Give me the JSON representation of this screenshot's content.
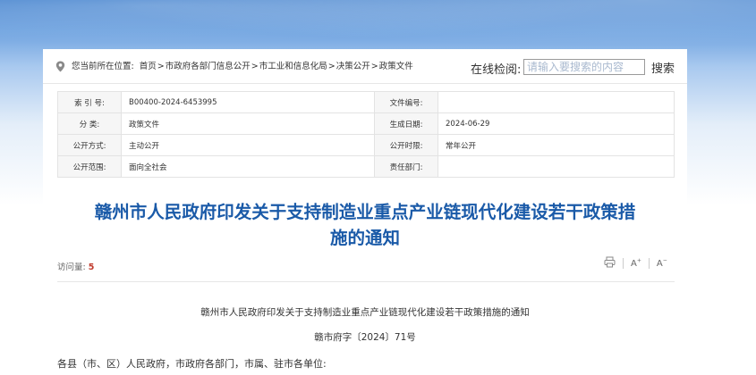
{
  "breadcrumb": {
    "prefix": "您当前所在位置:",
    "items": [
      "首页",
      "市政府各部门信息公开",
      "市工业和信息化局",
      "决策公开",
      "政策文件"
    ],
    "separator": ">"
  },
  "search": {
    "label": "在线检阅:",
    "placeholder": "请输入要搜索的内容",
    "button": "搜索"
  },
  "info_table": {
    "rows": [
      {
        "k1": "索 引 号:",
        "v1": "B00400-2024-6453995",
        "k2": "文件编号:",
        "v2": ""
      },
      {
        "k1": "分    类:",
        "v1": "政策文件",
        "k2": "生成日期:",
        "v2": "2024-06-29"
      },
      {
        "k1": "公开方式:",
        "v1": "主动公开",
        "k2": "公开时限:",
        "v2": "常年公开"
      },
      {
        "k1": "公开范围:",
        "v1": "面向全社会",
        "k2": "责任部门:",
        "v2": ""
      }
    ]
  },
  "article": {
    "title_line1": "赣州市人民政府印发关于支持制造业重点产业链现代化建设若干政策措",
    "title_line2": "施的通知",
    "visits_label": "访问量:",
    "visits_count": "5",
    "font_larger": "A",
    "font_smaller": "A",
    "doc_heading": "赣州市人民政府印发关于支持制造业重点产业链现代化建设若干政策措施的通知",
    "doc_number": "赣市府字〔2024〕71号",
    "salutation": "各县（市、区）人民政府，市政府各部门，市属、驻市各单位:"
  },
  "colors": {
    "title": "#1a5aa8",
    "visits_count": "#c0392b",
    "header_gradient_top": "#3f7fcd"
  },
  "icons": [
    "location-icon",
    "print-icon",
    "font-increase-icon",
    "font-decrease-icon"
  ]
}
